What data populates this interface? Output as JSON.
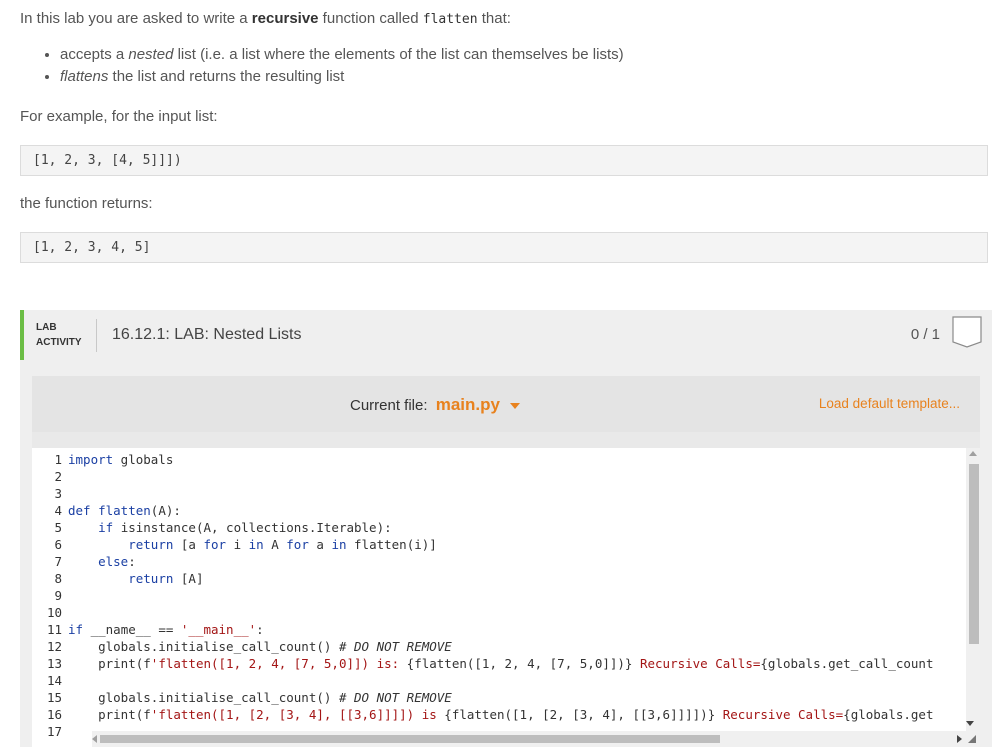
{
  "intro": {
    "prefix": "In this lab you are asked to write a ",
    "bold": "recursive",
    "middle": " function called ",
    "code": "flatten",
    "suffix": " that:"
  },
  "bullets": [
    {
      "pre": "accepts a ",
      "em": "nested",
      "post": " list (i.e. a list where the elements of the list can themselves be lists)"
    },
    {
      "pre": "",
      "em": "flattens",
      "post": " the list and returns the resulting list"
    }
  ],
  "example_label": "For example, for the input list:",
  "example_input": "[1, 2, 3, [4, 5]]])",
  "returns_label": "the function returns:",
  "example_output": "[1, 2, 3, 4, 5]",
  "lab": {
    "tag_line1": "LAB",
    "tag_line2": "ACTIVITY",
    "title": "16.12.1: LAB: Nested Lists",
    "score": "0 / 1",
    "accent": "#6bbd45"
  },
  "toolbar": {
    "current_file_label": "Current file:",
    "filename": "main.py",
    "load_default": "Load default template...",
    "link_color": "#e8821e"
  },
  "code_lines": [
    {
      "n": "1",
      "tokens": [
        [
          "kw",
          "import"
        ],
        [
          "tx",
          " globals"
        ]
      ]
    },
    {
      "n": "2",
      "tokens": []
    },
    {
      "n": "3",
      "tokens": []
    },
    {
      "n": "4",
      "tokens": [
        [
          "kw",
          "def"
        ],
        [
          "tx",
          " "
        ],
        [
          "fn",
          "flatten"
        ],
        [
          "tx",
          "(A):"
        ]
      ]
    },
    {
      "n": "5",
      "tokens": [
        [
          "tx",
          "    "
        ],
        [
          "kw",
          "if"
        ],
        [
          "tx",
          " isinstance(A, collections.Iterable):"
        ]
      ]
    },
    {
      "n": "6",
      "tokens": [
        [
          "tx",
          "        "
        ],
        [
          "kw",
          "return"
        ],
        [
          "tx",
          " [a "
        ],
        [
          "kw",
          "for"
        ],
        [
          "tx",
          " i "
        ],
        [
          "kw",
          "in"
        ],
        [
          "tx",
          " A "
        ],
        [
          "kw",
          "for"
        ],
        [
          "tx",
          " a "
        ],
        [
          "kw",
          "in"
        ],
        [
          "tx",
          " flatten(i)]"
        ]
      ]
    },
    {
      "n": "7",
      "tokens": [
        [
          "tx",
          "    "
        ],
        [
          "kw",
          "else"
        ],
        [
          "tx",
          ":"
        ]
      ]
    },
    {
      "n": "8",
      "tokens": [
        [
          "tx",
          "        "
        ],
        [
          "kw",
          "return"
        ],
        [
          "tx",
          " [A]"
        ]
      ]
    },
    {
      "n": "9",
      "tokens": []
    },
    {
      "n": "10",
      "tokens": []
    },
    {
      "n": "11",
      "tokens": [
        [
          "kw",
          "if"
        ],
        [
          "tx",
          " __name__ == "
        ],
        [
          "st",
          "'__main__'"
        ],
        [
          "tx",
          ":"
        ]
      ]
    },
    {
      "n": "12",
      "tokens": [
        [
          "tx",
          "    globals.initialise_call_count() "
        ],
        [
          "cm",
          "# DO NOT REMOVE"
        ]
      ]
    },
    {
      "n": "13",
      "tokens": [
        [
          "tx",
          "    print(f"
        ],
        [
          "st",
          "'flatten([1, 2, 4, [7, 5,0]]) is: "
        ],
        [
          "tx",
          "{flatten([1, 2, 4, [7, 5,0]])}"
        ],
        [
          "st",
          " Recursive Calls="
        ],
        [
          "tx",
          "{globals.get_call_count"
        ]
      ]
    },
    {
      "n": "14",
      "tokens": []
    },
    {
      "n": "15",
      "tokens": [
        [
          "tx",
          "    globals.initialise_call_count() "
        ],
        [
          "cm",
          "# DO NOT REMOVE"
        ]
      ]
    },
    {
      "n": "16",
      "tokens": [
        [
          "tx",
          "    print(f"
        ],
        [
          "st",
          "'flatten([1, [2, [3, 4], [[3,6]]]]) is "
        ],
        [
          "tx",
          "{flatten([1, [2, [3, 4], [[3,6]]]])}"
        ],
        [
          "st",
          " Recursive Calls="
        ],
        [
          "tx",
          "{globals.get"
        ]
      ]
    },
    {
      "n": "17",
      "tokens": []
    }
  ]
}
